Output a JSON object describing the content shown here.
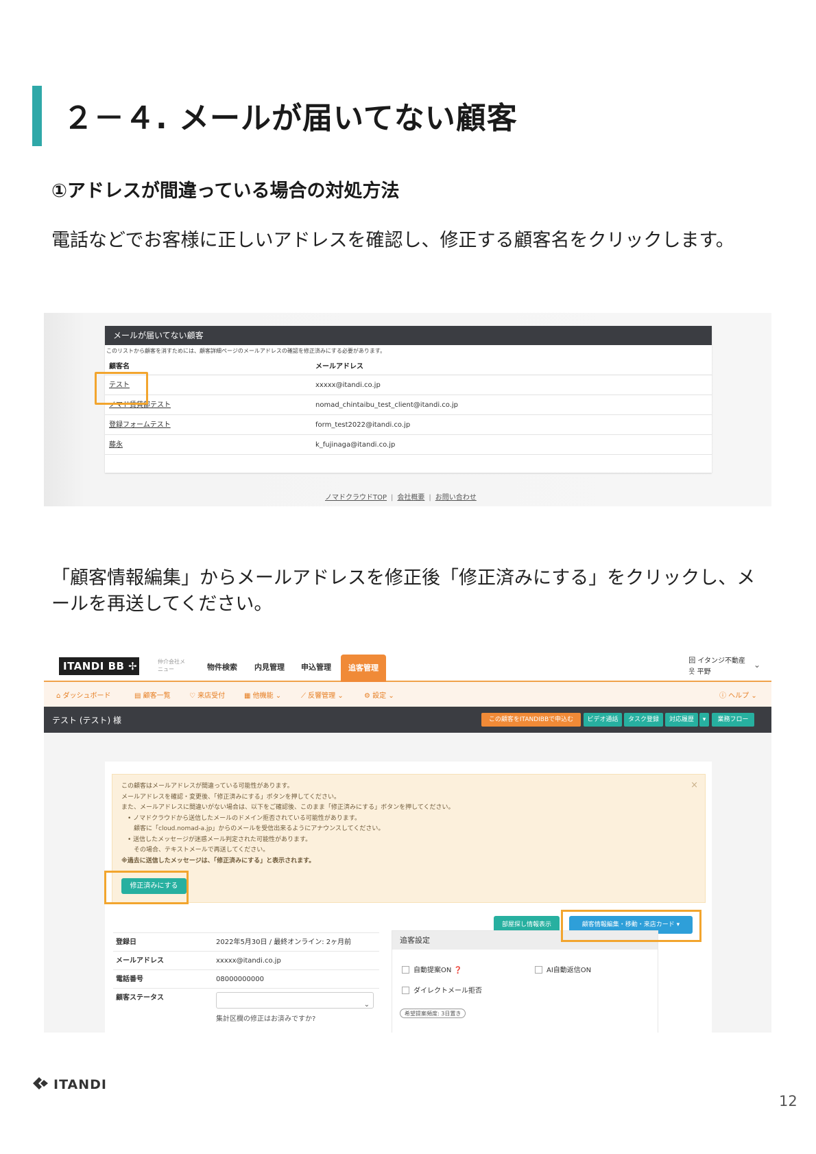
{
  "page": {
    "title": "２－４. メールが届いてない顧客",
    "section_heading": "①アドレスが間違っている場合の対処方法",
    "paragraph1": "電話などでお客様に正しいアドレスを確認し、修正する顧客名をクリックします。",
    "paragraph2": "「顧客情報編集」からメールアドレスを修正後「修正済みにする」をクリックし、メールを再送してください。",
    "brand": "ITANDI",
    "page_number": "12",
    "accent_color": "#2fa8a8",
    "highlight_color": "#f2a52e"
  },
  "screenshot1": {
    "card_title": "メールが届いてない顧客",
    "note": "このリストから顧客を消すためには、顧客詳細ページのメールアドレスの確認を修正済みにする必要があります。",
    "columns": [
      "顧客名",
      "メールアドレス"
    ],
    "rows": [
      {
        "name": "テスト",
        "email": "xxxxx@itandi.co.jp"
      },
      {
        "name": "ノマド賃貸部テスト",
        "email": "nomad_chintaibu_test_client@itandi.co.jp"
      },
      {
        "name": "登録フォームテスト",
        "email": "form_test2022@itandi.co.jp"
      },
      {
        "name": "藤永",
        "email": "k_fujinaga@itandi.co.jp"
      }
    ],
    "footer_links": [
      "ノマドクラウドTOP",
      "会社概要",
      "お問い合わせ"
    ],
    "footer_separator": "|"
  },
  "screenshot2": {
    "logo": "ITANDI BB ✢",
    "menu_label": "仲介会社メニュー",
    "nav": [
      "物件検索",
      "内見管理",
      "申込管理"
    ],
    "nav_active": "追客管理",
    "company": "回 イタンジ不動産",
    "user": "웃 平野",
    "company_chevron": "⌄",
    "subnav": [
      "⌂ ダッシュボード",
      "▤ 顧客一覧",
      "♡ 来店受付",
      "▦ 他機能 ⌄",
      "⟋ 反響管理 ⌄",
      "⚙ 設定 ⌄"
    ],
    "help": "ⓘ ヘルプ ⌄",
    "customer_title": "テスト (テスト) 様",
    "customer_buttons": [
      "この顧客をITANDIBBで申込む",
      "ビデオ通話",
      "タスク登録",
      "対応履歴",
      "▾",
      "業務フロー"
    ],
    "alert_lines": [
      "この顧客はメールアドレスが間違っている可能性があります。",
      "メールアドレスを確認・変更後、「修正済みにする」ボタンを押してください。",
      "また、メールアドレスに間違いがない場合は、以下をご確認後、このまま「修正済みにする」ボタンを押してください。",
      "　• ノマドクラウドから送信したメールのドメイン拒否されている可能性があります。",
      "　　顧客に「cloud.nomad-a.jp」からのメールを受信出来るようにアナウンスしてください。",
      "　• 送信したメッセージが迷惑メール判定された可能性があります。",
      "　　その場合、テキストメールで再送してください。",
      "※過去に送信したメッセージは、「修正済みにする」と表示されます。"
    ],
    "alert_close": "×",
    "fix_button": "修正済みにする",
    "room_button": "部屋探し情報表示",
    "edit_button": "顧客情報編集・移動・来店カード ▾",
    "info": [
      {
        "label": "登録日",
        "value": "2022年5月30日 / 最終オンライン: 2ヶ月前"
      },
      {
        "label": "メールアドレス",
        "value": "xxxxx@itandi.co.jp"
      },
      {
        "label": "電話番号",
        "value": "08000000000"
      },
      {
        "label": "顧客ステータス",
        "value": ""
      }
    ],
    "status_chevron": "⌄",
    "cut_text": "集計区欄の修正はお済みですか?",
    "tracking_title": "追客設定",
    "tracking_options": [
      "自動提案ON ❓",
      "AI自動返信ON",
      "ダイレクトメール拒否"
    ],
    "tracking_pill": "希望提案頻度: 3日置き"
  }
}
